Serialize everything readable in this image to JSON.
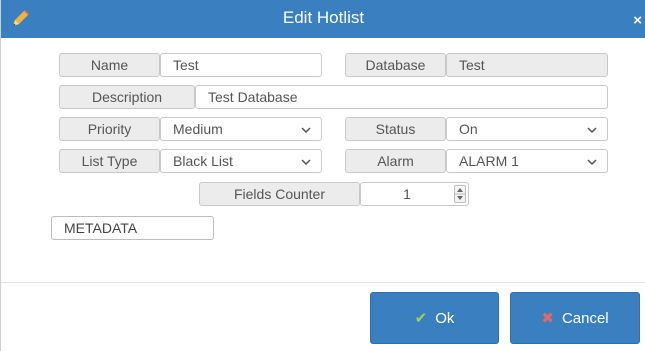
{
  "dialog": {
    "title": "Edit Hotlist",
    "close_glyph": "×",
    "title_icon": "pencil-icon"
  },
  "form": {
    "name_label": "Name",
    "name_value": "Test",
    "database_label": "Database",
    "database_value": "Test",
    "description_label": "Description",
    "description_value": "Test Database",
    "priority_label": "Priority",
    "priority_value": "Medium",
    "status_label": "Status",
    "status_value": "On",
    "list_type_label": "List Type",
    "list_type_value": "Black List",
    "alarm_label": "Alarm",
    "alarm_value": "ALARM 1",
    "fields_counter_label": "Fields Counter",
    "fields_counter_value": "1",
    "metadata_label": "METADATA"
  },
  "buttons": {
    "ok_label": "Ok",
    "ok_icon": "checkmark-icon",
    "cancel_label": "Cancel",
    "cancel_icon": "x-icon"
  },
  "colors": {
    "accent": "#3a80c1",
    "ok_icon": "#9bd35a",
    "cancel_icon": "#e06a6a"
  }
}
